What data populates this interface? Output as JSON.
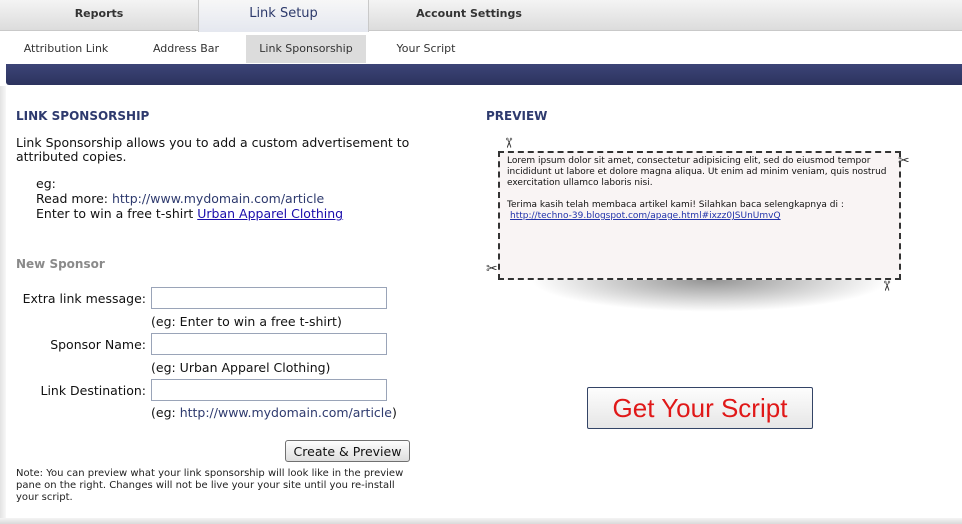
{
  "top_tabs": {
    "reports": "Reports",
    "link_setup": "Link Setup",
    "account_settings": "Account Settings"
  },
  "sub_tabs": {
    "attribution_link": "Attribution Link",
    "address_bar": "Address Bar",
    "link_sponsorship": "Link Sponsorship",
    "your_script": "Your Script"
  },
  "left": {
    "heading": "LINK SPONSORSHIP",
    "description": "Link Sponsorship allows you to add a custom advertisement to attributed copies.",
    "eg_label": "eg:",
    "read_more_label": "Read more:",
    "read_more_url": "http://www.mydomain.com/article",
    "win_text": "Enter to win a free t-shirt",
    "win_link": "Urban Apparel Clothing",
    "new_sponsor": "New Sponsor",
    "fields": {
      "extra_label": "Extra link message:",
      "extra_value": "",
      "extra_hint": "(eg: Enter to win a free t-shirt)",
      "sponsor_label": "Sponsor Name:",
      "sponsor_value": "",
      "sponsor_hint": "(eg: Urban Apparel Clothing)",
      "dest_label": "Link Destination:",
      "dest_value": "",
      "dest_hint_prefix": "(eg: ",
      "dest_hint_url": "http://www.mydomain.com/article",
      "dest_hint_suffix": ")"
    },
    "create_button": "Create & Preview",
    "note": "Note: You can preview what your link sponsorship will look like in the preview pane on the right. Changes will not be live your your site until you re-install your script."
  },
  "preview": {
    "heading": "PREVIEW",
    "lorem": "Lorem ipsum dolor sit amet, consectetur adipisicing elit, sed do eiusmod tempor incididunt ut labore et dolore magna aliqua. Ut enim ad minim veniam, quis nostrud exercitation ullamco laboris nisi.",
    "thanks": "Terima kasih telah membaca artikel kami! Silahkan baca selengkapnya di :",
    "url": "http://techno-39.blogspot.com/apage.html#ixzz0JSUnUmvQ",
    "scissors_icon": "scissors-icon"
  },
  "get_script_button": "Get Your Script",
  "colors": {
    "accent": "#2e3a6e",
    "bar": "#343b6a",
    "cta_text": "#e01818"
  }
}
